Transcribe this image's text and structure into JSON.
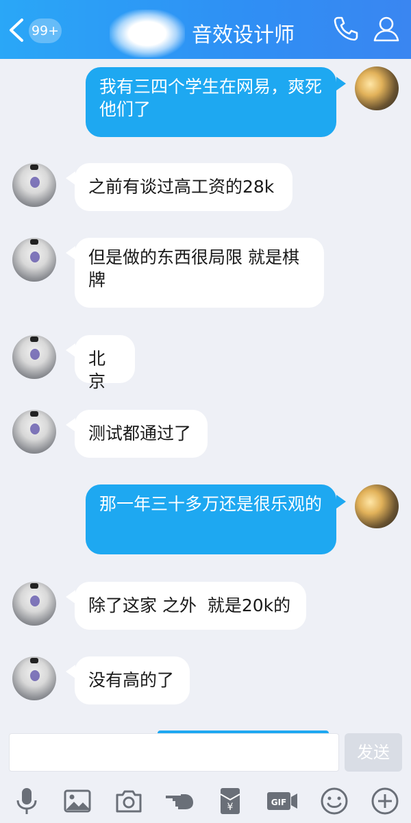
{
  "header": {
    "unread_badge": "99+",
    "title": "音效设计师"
  },
  "messages": [
    {
      "side": "right",
      "text": "我有三四个学生在网易，爽死他们了"
    },
    {
      "side": "left",
      "text": "之前有谈过高工资的28k"
    },
    {
      "side": "left",
      "text": "但是做的东西很局限 就是棋牌"
    },
    {
      "side": "left",
      "text": "北京"
    },
    {
      "side": "left",
      "text": "测试都通过了"
    },
    {
      "side": "right",
      "text": "那一年三十多万还是很乐观的"
    },
    {
      "side": "left",
      "text": "除了这家 之外  就是20k的"
    },
    {
      "side": "left",
      "text": "没有高的了"
    }
  ],
  "input": {
    "value": "",
    "send_label": "发送"
  },
  "toolbar": [
    {
      "icon": "microphone-icon"
    },
    {
      "icon": "image-icon"
    },
    {
      "icon": "camera-icon"
    },
    {
      "icon": "poke-hand-icon"
    },
    {
      "icon": "red-packet-icon"
    },
    {
      "icon": "gif-icon"
    },
    {
      "icon": "emoji-icon"
    },
    {
      "icon": "plus-icon"
    }
  ],
  "colors": {
    "header": "#2f8ff4",
    "bubble_out": "#1ea8f1",
    "bubble_in": "#ffffff",
    "background": "#eef0f6"
  }
}
